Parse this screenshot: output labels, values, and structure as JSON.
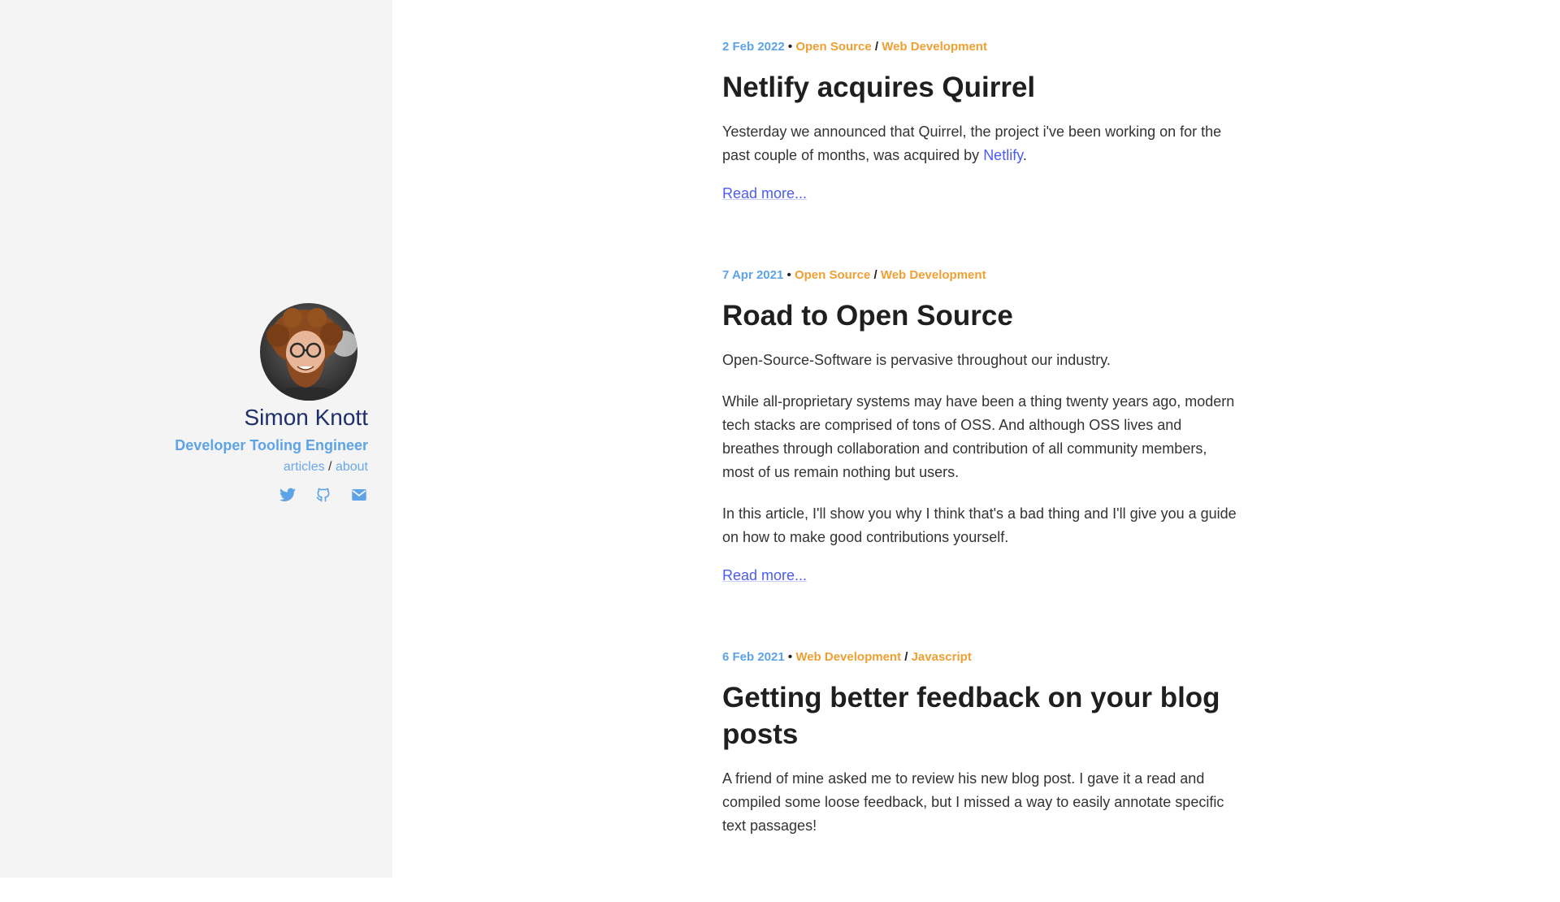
{
  "sidebar": {
    "name": "Simon Knott",
    "role": "Developer Tooling Engineer",
    "nav": [
      {
        "label": "articles"
      },
      {
        "label": "about"
      }
    ],
    "nav_separator": "/",
    "socials": [
      {
        "icon": "twitter-icon"
      },
      {
        "icon": "github-icon"
      },
      {
        "icon": "mail-icon"
      }
    ]
  },
  "posts": [
    {
      "date": "2 Feb 2022",
      "tags": [
        "Open Source",
        "Web Development"
      ],
      "title": "Netlify acquires Quirrel",
      "paragraphs": [
        {
          "before": "Yesterday we announced that Quirrel, the project i've been working on for the past couple of months, was acquired by ",
          "link": "Netlify",
          "after": "."
        }
      ],
      "read_more": "Read more..."
    },
    {
      "date": "7 Apr 2021",
      "tags": [
        "Open Source",
        "Web Development"
      ],
      "title": "Road to Open Source",
      "paragraphs": [
        {
          "text": "Open-Source-Software is pervasive throughout our industry."
        },
        {
          "text": "While all-proprietary systems may have been a thing twenty years ago, modern tech stacks are comprised of tons of OSS. And although OSS lives and breathes through collaboration and contribution of all community members, most of us remain nothing but users."
        },
        {
          "text": "In this article, I'll show you why I think that's a bad thing and I'll give you a guide on how to make good contributions yourself."
        }
      ],
      "read_more": "Read more..."
    },
    {
      "date": "6 Feb 2021",
      "tags": [
        "Web Development",
        "Javascript"
      ],
      "title": "Getting better feedback on your blog posts",
      "paragraphs": [
        {
          "text": "A friend of mine asked me to review his new blog post. I gave it a read and compiled some loose feedback, but I missed a way to easily annotate specific text passages!"
        }
      ]
    }
  ],
  "meta_separator": "•",
  "tag_separator": "/",
  "colors": {
    "sidebar_bg": "#f4f4f5",
    "name": "#1e2f6b",
    "accent_blue": "#5da3e6",
    "tag_orange": "#f0a033",
    "link": "#4d5cf0"
  }
}
